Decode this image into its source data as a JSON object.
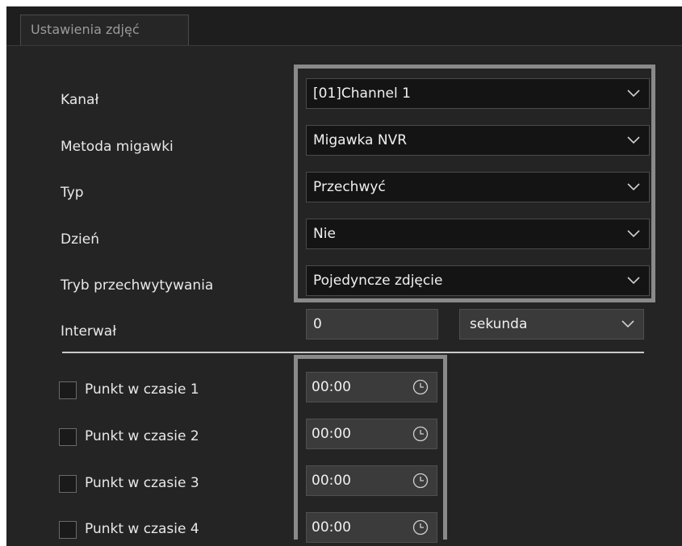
{
  "tab": {
    "label": "Ustawienia zdjęć"
  },
  "form": {
    "channel": {
      "label": "Kanał",
      "value": "[01]Channel 1"
    },
    "method": {
      "label": "Metoda migawki",
      "value": "Migawka NVR"
    },
    "type": {
      "label": "Typ",
      "value": "Przechwyć"
    },
    "day": {
      "label": "Dzień",
      "value": "Nie"
    },
    "capture_mode": {
      "label": "Tryb przechwytywania",
      "value": "Pojedyncze zdjęcie"
    },
    "interval": {
      "label": "Interwał",
      "value": "0",
      "unit": "sekunda"
    }
  },
  "time_points": [
    {
      "label": "Punkt w czasie 1",
      "value": "00:00",
      "checked": false
    },
    {
      "label": "Punkt w czasie 2",
      "value": "00:00",
      "checked": false
    },
    {
      "label": "Punkt w czasie 3",
      "value": "00:00",
      "checked": false
    },
    {
      "label": "Punkt w czasie 4",
      "value": "00:00",
      "checked": false
    }
  ],
  "icons": {
    "dropdown": "chevron-down-icon",
    "time": "clock-icon"
  },
  "colors": {
    "background": "#242424",
    "field": "#141414",
    "highlight": "#8a8a8a"
  }
}
